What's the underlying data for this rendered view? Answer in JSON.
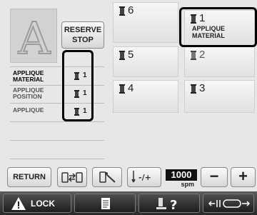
{
  "pattern": {
    "letter": "A"
  },
  "reserve_stop": {
    "line1": "RESERVE",
    "line2": "STOP"
  },
  "needles": [
    {
      "number": "6",
      "label": ""
    },
    {
      "number": "1",
      "label": "APPLIQUE\nMATERIAL"
    },
    {
      "number": "5",
      "label": ""
    },
    {
      "number": "2",
      "label": ""
    },
    {
      "number": "4",
      "label": ""
    },
    {
      "number": "3",
      "label": ""
    }
  ],
  "applique_list": [
    {
      "label": "APPLIQUE\nMATERIAL",
      "needle": "1"
    },
    {
      "label": "APPLIQUE\nPOSITION",
      "needle": "1"
    },
    {
      "label": "APPLIQUE",
      "needle": "1"
    }
  ],
  "toolbar": {
    "return_label": "RETURN",
    "speed_value": "1000",
    "speed_unit": "spm",
    "minus": "−",
    "plus": "+"
  },
  "status_bar": {
    "lock_label": "LOCK"
  },
  "colors": {
    "highlight": "#000000",
    "accent": "#111111"
  }
}
